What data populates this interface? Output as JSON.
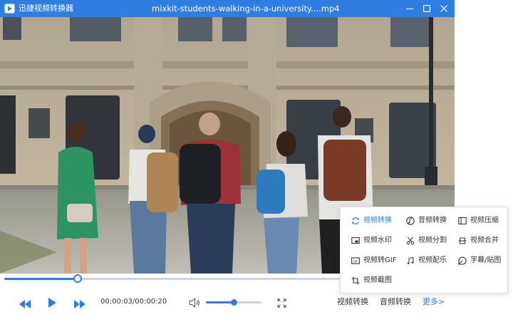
{
  "window": {
    "app_name": "迅捷视频转换器",
    "file_name": "mixkit-students-walking-in-a-university....mp4"
  },
  "colors": {
    "accent": "#2f7de1",
    "titlebar": "#2f7de1"
  },
  "player": {
    "time": "00:00:03/00:00:20",
    "progress": 0.166,
    "volume": 0.5
  },
  "bottom_bar": {
    "video_convert": "视频转换",
    "audio_convert": "音频转换",
    "more": "更多>"
  },
  "menu": {
    "items": [
      {
        "label": "视频转换",
        "icon": "refresh-icon",
        "active": true
      },
      {
        "label": "音频转换",
        "icon": "music-note-icon",
        "active": false
      },
      {
        "label": "视频压缩",
        "icon": "compress-icon",
        "active": false
      },
      {
        "label": "视频水印",
        "icon": "watermark-icon",
        "active": false
      },
      {
        "label": "视频分割",
        "icon": "scissors-icon",
        "active": false
      },
      {
        "label": "视频合并",
        "icon": "merge-icon",
        "active": false
      },
      {
        "label": "视频转GIF",
        "icon": "gif-icon",
        "active": false
      },
      {
        "label": "视频配乐",
        "icon": "music-add-icon",
        "active": false
      },
      {
        "label": "字幕/贴图",
        "icon": "sticker-icon",
        "active": false
      },
      {
        "label": "视频截图",
        "icon": "screenshot-icon",
        "active": false
      }
    ]
  }
}
